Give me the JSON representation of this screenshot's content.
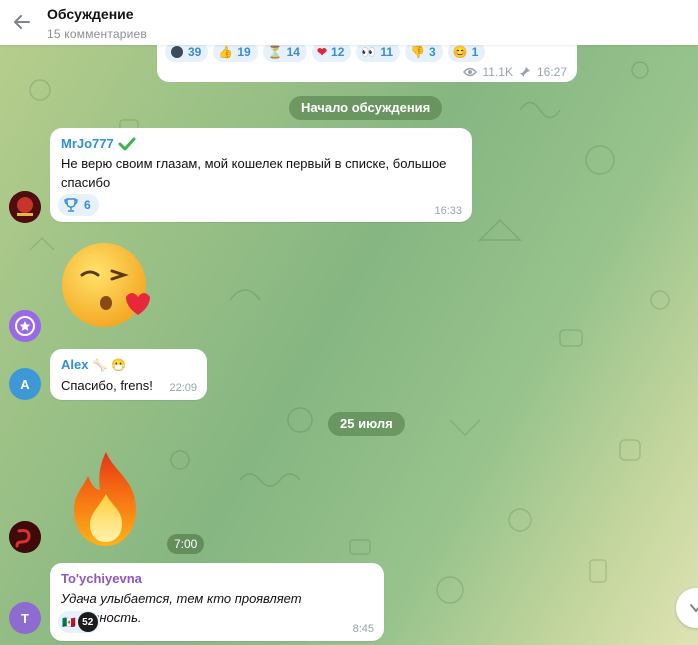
{
  "header": {
    "title": "Обсуждение",
    "subtitle": "15 комментариев"
  },
  "post": {
    "reactions": [
      {
        "icon": "dark-face-emoji",
        "count": "39"
      },
      {
        "icon": "thumbs-up-emoji",
        "count": "19"
      },
      {
        "icon": "hourglass-emoji",
        "count": "14"
      },
      {
        "icon": "heart-emoji",
        "count": "12"
      },
      {
        "icon": "eyes-emoji",
        "count": "11"
      },
      {
        "icon": "thumbs-down-emoji",
        "count": "3"
      },
      {
        "icon": "baby-face-emoji",
        "count": "1"
      }
    ],
    "views": "11.1K",
    "time": "16:27"
  },
  "date_start": "Начало обсуждения",
  "date_july": "25 июля",
  "messages": [
    {
      "author": "MrJo777",
      "author_color": "#2f8fd8",
      "text": "Не верю своим глазам, мой кошелек первый в списке, большое спасибо",
      "reaction": {
        "icon": "trophy-icon",
        "count": "6"
      },
      "time": "16:33"
    },
    {
      "sticker": "kiss-face-sticker",
      "sender_avatar": "purple-star-avatar"
    },
    {
      "author": "Alex",
      "author_color": "#2f8fd8",
      "avatar_letter": "A",
      "text": "Спасибо, frens!",
      "time": "22:09"
    },
    {
      "sticker": "fire-sticker",
      "time": "7:00"
    },
    {
      "author": "To'ychiyevna",
      "author_color": "#8e56c2",
      "avatar_letter": "T",
      "text": "Удача улыбается, тем кто проявляет активность.",
      "reaction_count": "52",
      "time": "8:45"
    }
  ],
  "colors": {
    "accent": "#3a8bd6",
    "avatar_a": "#3f98d6",
    "avatar_t": "#8e6bd0"
  }
}
